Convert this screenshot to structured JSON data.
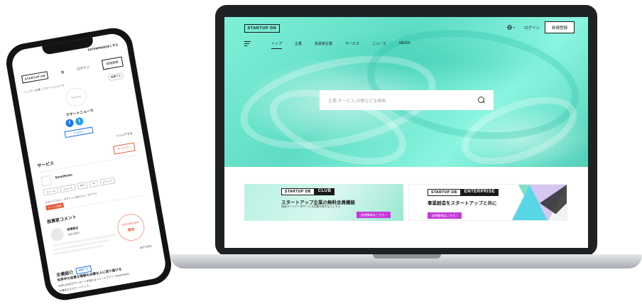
{
  "desktop": {
    "logo": "STARTUP DB",
    "header": {
      "language_icon": "globe-icon",
      "login_label": "ログイン",
      "signup_label": "新規登録"
    },
    "nav": [
      "トップ",
      "企業",
      "投資家企業",
      "サービス",
      "ニュース",
      "MEDIA"
    ],
    "search": {
      "placeholder": "企業,サービス,分野などを検索"
    },
    "banners": [
      {
        "tag_left": "STARTUP DB",
        "tag_right": "CLUB",
        "title": "スタートアップ企業の無料会員機能",
        "subtitle": "気になる企業や…",
        "subtitle_full": "成長パートナーのサービス対象を探すならこちら",
        "button": "詳細情報はこちら"
      },
      {
        "tag_left": "STARTUP DB",
        "tag_right": "ENTERPRISE",
        "title": "事業創造をスタートアップと共に",
        "button": "詳細情報はこちら"
      }
    ],
    "accent_colors": {
      "hero": "#6fe6cf",
      "cta": "#c639d8"
    }
  },
  "mobile": {
    "enterprise_link": "ENTERPRISEはこちら",
    "logo": "STARTUP DB",
    "login_label": "ログイン",
    "signup_label": "新規登録",
    "breadcrumb": "トップ > 企業 > スマートニュース",
    "edit_label": "編集する",
    "company_logo": "SmartNews",
    "company_name": "スマートニュース",
    "follow_label": "フォロー",
    "share_label": "シェアする",
    "services_heading": "サービス",
    "services_button": "サービスへ",
    "service_name": "SmartNews",
    "service_tags": [
      "ニュース",
      "ニュース",
      "B2C",
      "AI",
      "メディア"
    ],
    "service_desc": "スマートフォン・タブレット向けニュースアプリ",
    "service_badge": "サービス概要",
    "investor_heading": "投資家コメント",
    "investor_name": "投資家名",
    "investor_role": "投資企業名",
    "limited_top": "DOCOMOSHI",
    "limited_label": "限定",
    "more_label": "続きを読む",
    "company_heading": "企業紹介",
    "company_edit": "編集する",
    "company_tagline": "世界中の良質な情報を必要な人に送り届ける",
    "company_desc": "日本5,000万ダウンロードを越えるニュースアプリ「SmartNews」",
    "company_desc2": "を運営するスタートアップ。"
  }
}
